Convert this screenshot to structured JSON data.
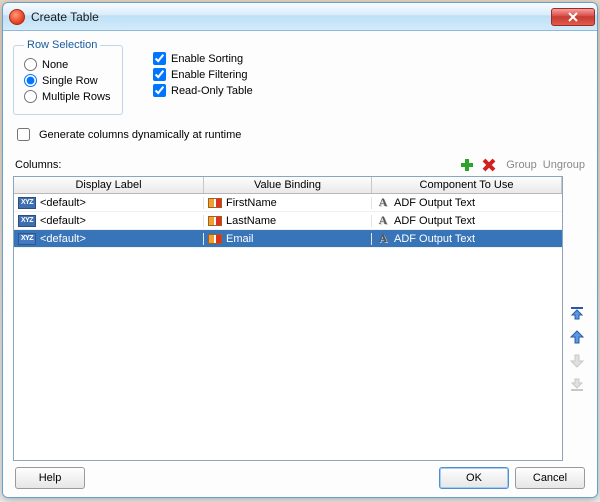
{
  "title": "Create Table",
  "rowSelection": {
    "legend": "Row Selection",
    "options": {
      "none": "None",
      "single": "Single Row",
      "multiple": "Multiple Rows"
    },
    "selected": "single"
  },
  "features": {
    "sorting": {
      "label": "Enable Sorting",
      "checked": true
    },
    "filtering": {
      "label": "Enable Filtering",
      "checked": true
    },
    "readonly": {
      "label": "Read-Only Table",
      "checked": true
    }
  },
  "generateDynamic": {
    "label": "Generate columns dynamically at runtime",
    "checked": false
  },
  "columnsLabel": "Columns:",
  "groupLabel": "Group",
  "ungroupLabel": "Ungroup",
  "headers": {
    "display": "Display Label",
    "binding": "Value Binding",
    "component": "Component To Use"
  },
  "rows": [
    {
      "display": "<default>",
      "binding": "FirstName",
      "component": "ADF Output Text",
      "selected": false
    },
    {
      "display": "<default>",
      "binding": "LastName",
      "component": "ADF Output Text",
      "selected": false
    },
    {
      "display": "<default>",
      "binding": "Email",
      "component": "ADF Output Text",
      "selected": true
    }
  ],
  "buttons": {
    "help": "Help",
    "ok": "OK",
    "cancel": "Cancel"
  }
}
